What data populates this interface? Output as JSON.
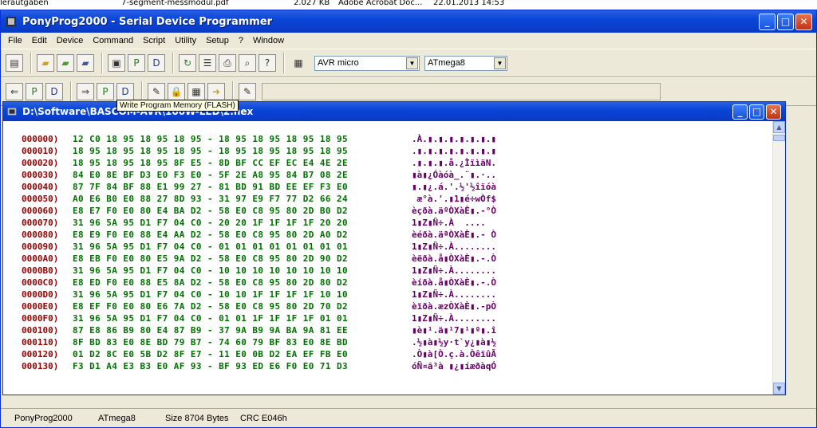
{
  "background": {
    "left_text": "lerautgaben",
    "file_name": "7-segment-messmodul.pdf",
    "file_size": "2.027 KB",
    "file_type": "Adobe Acrobat Doc...",
    "file_date": "22.01.2013 14:53"
  },
  "window": {
    "title": "PonyProg2000 - Serial Device Programmer"
  },
  "menu": [
    "File",
    "Edit",
    "Device",
    "Command",
    "Script",
    "Utility",
    "Setup",
    "?",
    "Window"
  ],
  "toolbar": {
    "device_family": "AVR micro",
    "device_model": "ATmega8"
  },
  "tooltip": "Write Program Memory (FLASH)",
  "child_window": {
    "title": "D:\\Software\\BASCOM-AVR\\100W-LED\\2.hex"
  },
  "hex_rows": [
    {
      "addr": "000000)",
      "bytes": "12 C0 18 95 18 95 18 95 - 18 95 18 95 18 95 18 95",
      "ascii": ".À.▮.▮.▮.▮.▮.▮.▮"
    },
    {
      "addr": "000010)",
      "bytes": "18 95 18 95 18 95 18 95 - 18 95 18 95 18 95 18 95",
      "ascii": ".▮.▮.▮.▮.▮.▮.▮.▮"
    },
    {
      "addr": "000020)",
      "bytes": "18 95 18 95 18 95 8F E5 - 8D BF CC EF EC E4 4E 2E",
      "ascii": ".▮.▮.▮.å.¿ÌïìäN."
    },
    {
      "addr": "000030)",
      "bytes": "84 E0 8E BF D3 E0 F3 E0 - 5F 2E A8 95 84 B7 08 2E",
      "ascii": "▮à▮¿Óàóà_.¨▮.·.."
    },
    {
      "addr": "000040)",
      "bytes": "87 7F 84 BF 88 E1 99 27 - 81 BD 91 BD EE EF F3 E0",
      "ascii": "▮.▮¿.á.'.½'½îïóà"
    },
    {
      "addr": "000050)",
      "bytes": "A0 E6 B0 E0 88 27 8D 93 - 31 97 E9 F7 77 D2 66 24",
      "ascii": " æ°à.'.▮1▮é÷wÒf$"
    },
    {
      "addr": "000060)",
      "bytes": "E8 E7 F0 E0 80 E4 BA D2 - 58 E0 C8 95 80 2D B0 D2",
      "ascii": "èçðà.äºÒXàÈ▮.-°Ò"
    },
    {
      "addr": "000070)",
      "bytes": "31 96 5A 95 D1 F7 04 C0 - 20 20 1F 1F 1F 1F 20 20",
      "ascii": "1▮Z▮Ñ÷.À  ....  "
    },
    {
      "addr": "000080)",
      "bytes": "E8 E9 F0 E0 88 E4 AA D2 - 58 E0 C8 95 80 2D A0 D2",
      "ascii": "èéðà.äªÒXàÈ▮.- Ò"
    },
    {
      "addr": "000090)",
      "bytes": "31 96 5A 95 D1 F7 04 C0 - 01 01 01 01 01 01 01 01",
      "ascii": "1▮Z▮Ñ÷.À........"
    },
    {
      "addr": "0000A0)",
      "bytes": "E8 EB F0 E0 80 E5 9A D2 - 58 E0 C8 95 80 2D 90 D2",
      "ascii": "èëðà.å▮ÒXàÈ▮.-.Ò"
    },
    {
      "addr": "0000B0)",
      "bytes": "31 96 5A 95 D1 F7 04 C0 - 10 10 10 10 10 10 10 10",
      "ascii": "1▮Z▮Ñ÷.À........"
    },
    {
      "addr": "0000C0)",
      "bytes": "E8 ED F0 E0 88 E5 8A D2 - 58 E0 C8 95 80 2D 80 D2",
      "ascii": "èíðà.å▮ÒXàÈ▮.-.Ò"
    },
    {
      "addr": "0000D0)",
      "bytes": "31 96 5A 95 D1 F7 04 C0 - 10 10 1F 1F 1F 1F 10 10",
      "ascii": "1▮Z▮Ñ÷.À........"
    },
    {
      "addr": "0000E0)",
      "bytes": "E8 EF F0 E0 80 E6 7A D2 - 58 E0 C8 95 80 2D 70 D2",
      "ascii": "èïðà.æzÒXàÈ▮.-pÒ"
    },
    {
      "addr": "0000F0)",
      "bytes": "31 96 5A 95 D1 F7 04 C0 - 01 01 1F 1F 1F 1F 01 01",
      "ascii": "1▮Z▮Ñ÷.À........"
    },
    {
      "addr": "000100)",
      "bytes": "87 E8 86 B9 80 E4 87 B9 - 37 9A B9 9A BA 9A 81 EE",
      "ascii": "▮è▮¹.ä▮¹7▮¹▮º▮.î"
    },
    {
      "addr": "000110)",
      "bytes": "8F BD 83 E0 8E BD 79 B7 - 74 60 79 BF 83 E0 8E BD",
      "ascii": ".½▮à▮½y·t`y¿▮à▮½"
    },
    {
      "addr": "000120)",
      "bytes": "01 D2 8C E0 5B D2 8F E7 - 11 E0 0B D2 EA EF FB E0",
      "ascii": ".Ò▮à[Ò.ç.à.ÒêïûÃ"
    },
    {
      "addr": "000130)",
      "bytes": "F3 D1 A4 E3 B3 E0 AF 93 - BF 93 ED E6 F0 E0 71 D3",
      "ascii": "óÑ¤ã³à ▮¿▮íæðàqÓ"
    }
  ],
  "status": {
    "app": "PonyProg2000",
    "device": "ATmega8",
    "size": "Size  8704 Bytes",
    "crc": "CRC  E046h"
  }
}
